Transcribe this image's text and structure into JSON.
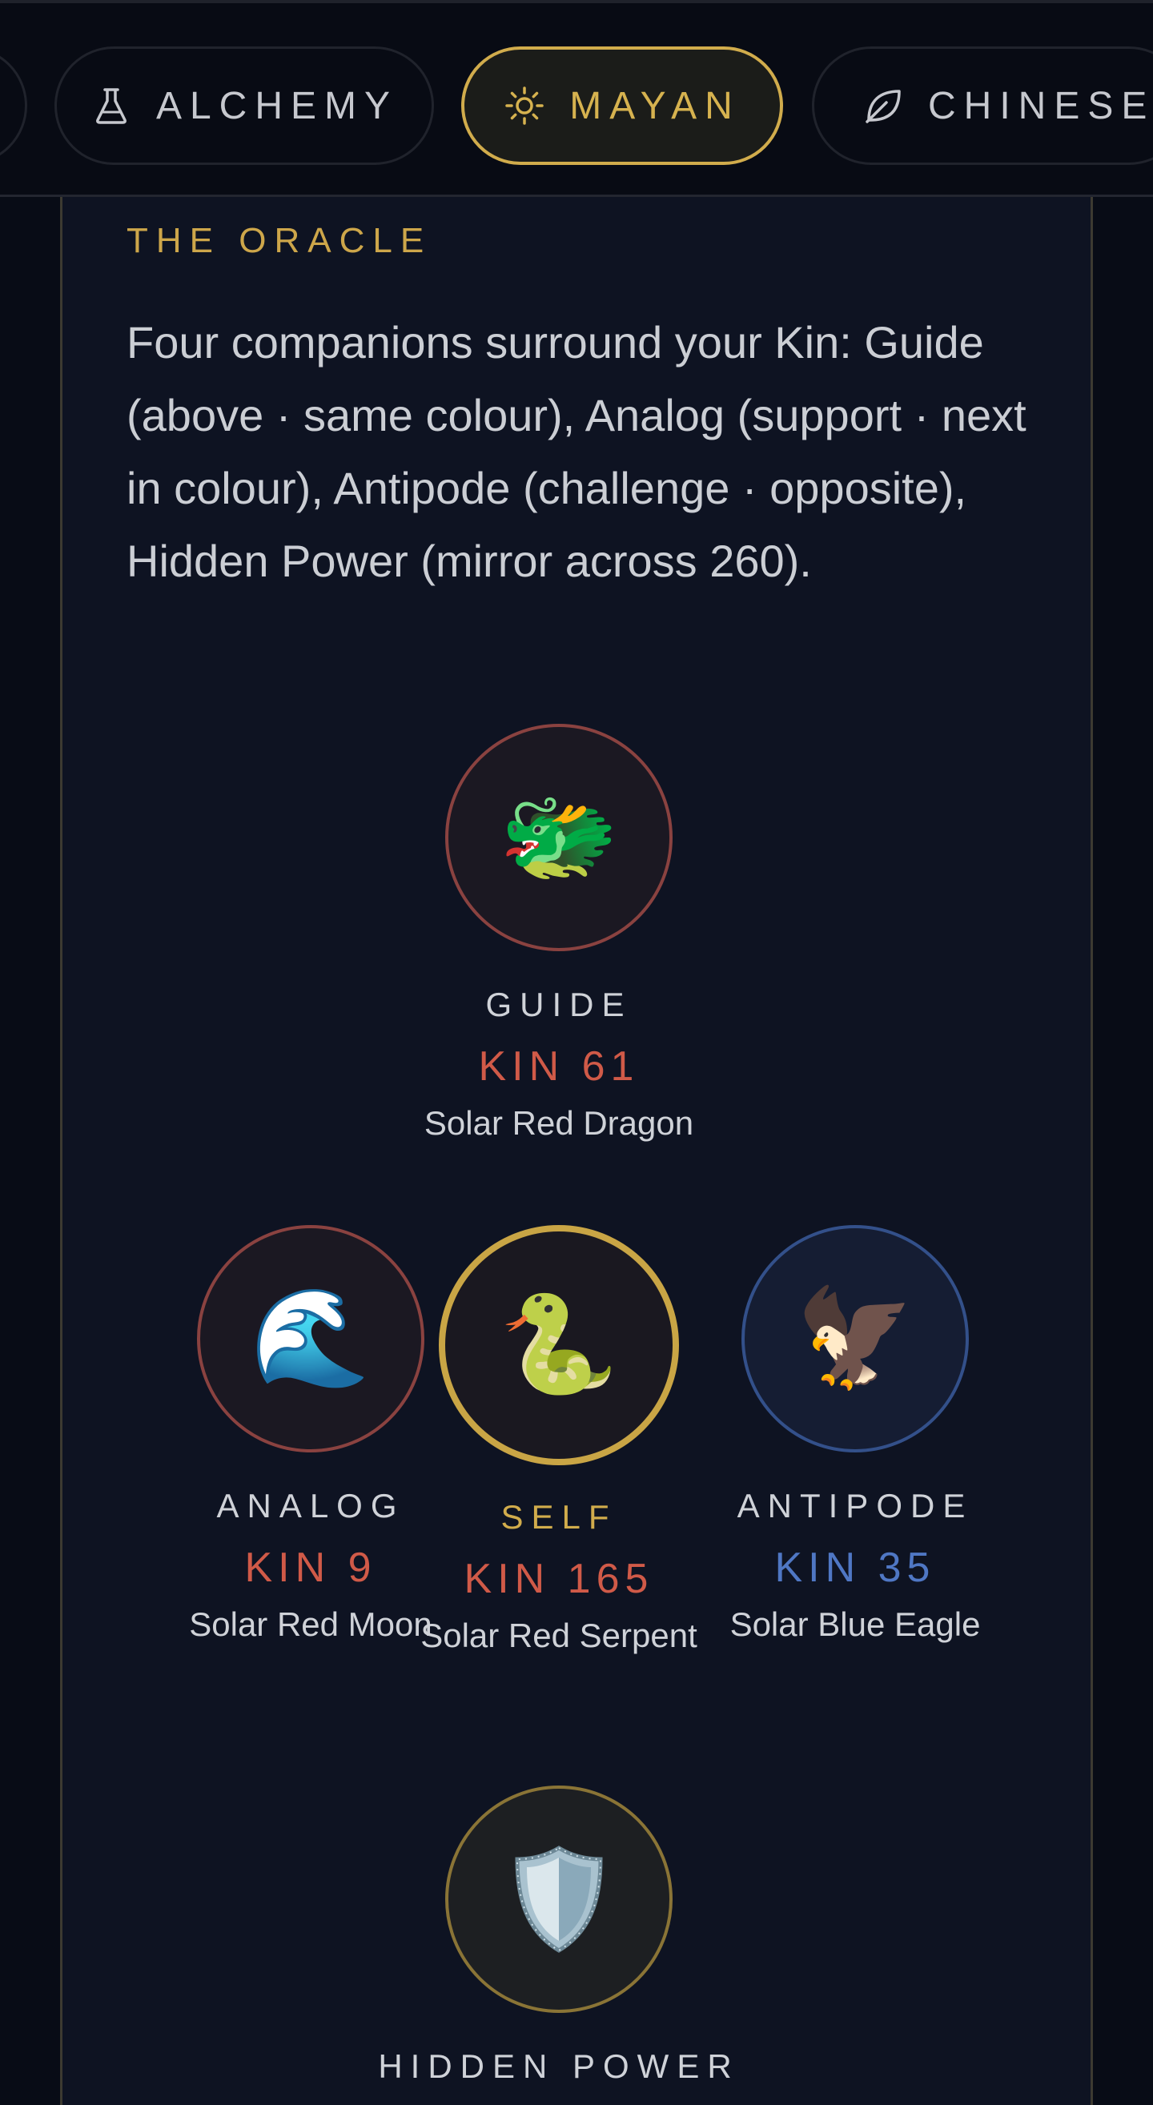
{
  "tabs": [
    {
      "label": ""
    },
    {
      "label": "ALCHEMY",
      "icon": "flask-icon"
    },
    {
      "label": "MAYAN",
      "icon": "sun-icon",
      "active": true
    },
    {
      "label": "CHINESE",
      "icon": "leaf-icon"
    }
  ],
  "oracle": {
    "title": "THE ORACLE",
    "description": "Four companions surround your Kin: Guide (above · same colour), Analog (support · next in colour), Antipode (challenge · opposite), Hidden Power (mirror across 260).",
    "companions": {
      "guide": {
        "role": "GUIDE",
        "kin": "KIN 61",
        "name": "Solar Red Dragon",
        "glyph": "🐲",
        "color": "#d05a48"
      },
      "analog": {
        "role": "ANALOG",
        "kin": "KIN 9",
        "name": "Solar Red Moon",
        "glyph": "🌊",
        "color": "#d05a48"
      },
      "self": {
        "role": "SELF",
        "kin": "KIN 165",
        "name": "Solar Red Serpent",
        "glyph": "🐍",
        "color": "#d05a48"
      },
      "antipode": {
        "role": "ANTIPODE",
        "kin": "KIN 35",
        "name": "Solar Blue Eagle",
        "glyph": "🦅",
        "color": "#4f77c4"
      },
      "hidden": {
        "role": "HIDDEN POWER",
        "glyph": "🛡"
      }
    }
  },
  "colors": {
    "accent_gold": "#d1ac4c",
    "red": "#d05a48",
    "blue": "#4f77c4",
    "background": "#0e1322"
  }
}
